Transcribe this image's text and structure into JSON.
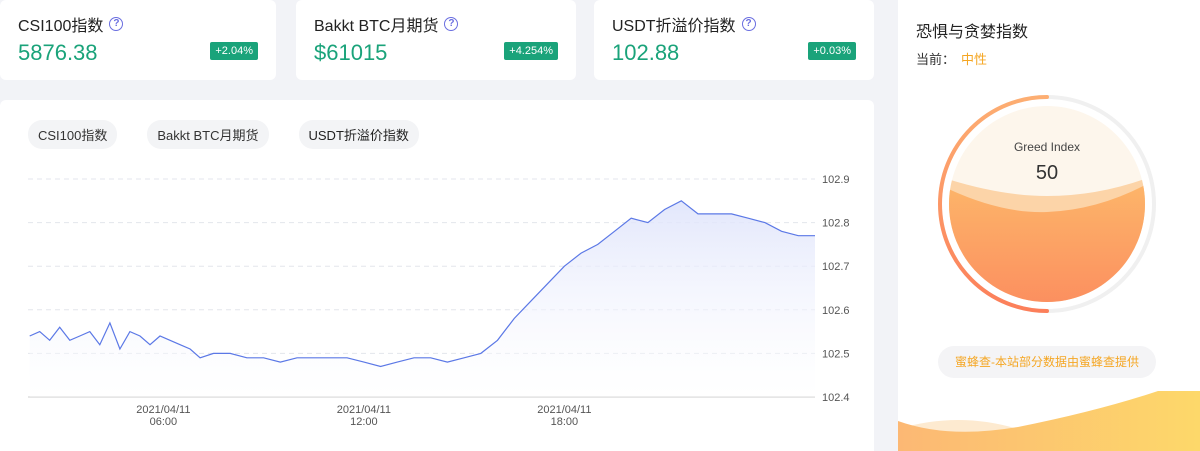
{
  "stats": [
    {
      "title": "CSI100指数",
      "value": "5876.38",
      "change": "+2.04%"
    },
    {
      "title": "Bakkt BTC月期货",
      "value": "$61015",
      "change": "+4.254%"
    },
    {
      "title": "USDT折溢价指数",
      "value": "102.88",
      "change": "+0.03%"
    }
  ],
  "tabs": [
    "CSI100指数",
    "Bakkt BTC月期货",
    "USDT折溢价指数"
  ],
  "active_tab": 2,
  "colors": {
    "accent_green": "#1aa37a",
    "line": "#5b78e6",
    "orange": "#f5a623"
  },
  "chart_data": {
    "type": "area",
    "title": "",
    "xlabel": "",
    "ylabel": "",
    "ylim": [
      102.4,
      102.9
    ],
    "y_ticks": [
      "102.9",
      "102.8",
      "102.7",
      "102.6",
      "102.5",
      "102.4"
    ],
    "x_ticks": [
      {
        "date": "2021/04/11",
        "time": "06:00",
        "hour": 6
      },
      {
        "date": "2021/04/11",
        "time": "12:00",
        "hour": 12
      },
      {
        "date": "2021/04/11",
        "time": "18:00",
        "hour": 18
      }
    ],
    "grid": true,
    "series": [
      {
        "x": [
          2.0,
          2.3,
          2.6,
          2.9,
          3.2,
          3.5,
          3.8,
          4.1,
          4.4,
          4.7,
          5.0,
          5.3,
          5.6,
          5.9,
          6.2,
          6.5,
          6.8,
          7.1,
          7.5,
          8.0,
          8.5,
          9.0,
          9.5,
          10.0,
          10.5,
          11.0,
          11.5,
          12.0,
          12.5,
          13.0,
          13.5,
          14.0,
          14.5,
          15.0,
          15.5,
          16.0,
          16.5,
          17.0,
          17.5,
          18.0,
          18.5,
          19.0,
          19.5,
          20.0,
          20.5,
          21.0,
          21.5,
          22.0,
          22.5,
          23.0,
          23.5,
          24.0,
          24.5,
          25.0,
          25.5
        ],
        "y": [
          102.54,
          102.55,
          102.53,
          102.56,
          102.53,
          102.54,
          102.55,
          102.52,
          102.57,
          102.51,
          102.55,
          102.54,
          102.52,
          102.54,
          102.53,
          102.52,
          102.51,
          102.49,
          102.5,
          102.5,
          102.49,
          102.49,
          102.48,
          102.49,
          102.49,
          102.49,
          102.49,
          102.48,
          102.47,
          102.48,
          102.49,
          102.49,
          102.48,
          102.49,
          102.5,
          102.53,
          102.58,
          102.62,
          102.66,
          102.7,
          102.73,
          102.75,
          102.78,
          102.81,
          102.8,
          102.83,
          102.85,
          102.82,
          102.82,
          102.82,
          102.81,
          102.8,
          102.78,
          102.77,
          102.77
        ]
      }
    ]
  },
  "greed": {
    "title": "恐惧与贪婪指数",
    "current_label": "当前：",
    "current_value": "中性",
    "index_label": "Greed Index",
    "index_value": "50",
    "source": "蜜蜂查-本站部分数据由蜜蜂查提供"
  }
}
